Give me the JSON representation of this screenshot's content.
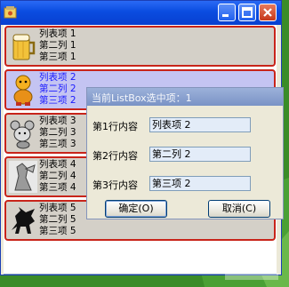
{
  "window": {
    "title": "",
    "buttons": [
      "minimize-button",
      "maximize-button",
      "close-button"
    ]
  },
  "list": {
    "items": [
      {
        "icon": "beer-mug-icon",
        "lines": [
          "列表项 1",
          "第二列 1",
          "第三项 1"
        ],
        "selected": false
      },
      {
        "icon": "cartoon-character-icon",
        "lines": [
          "列表项 2",
          "第二列 2",
          "第三项 2"
        ],
        "selected": true
      },
      {
        "icon": "mouse-character-icon",
        "lines": [
          "列表项 3",
          "第二列 3",
          "第三项 3"
        ],
        "selected": false
      },
      {
        "icon": "figure-icon",
        "lines": [
          "列表项 4",
          "第二列 4",
          "第三项 4"
        ],
        "selected": false
      },
      {
        "icon": "pegasus-icon",
        "lines": [
          "列表项 5",
          "第二列 5",
          "第三项 5"
        ],
        "selected": false
      }
    ]
  },
  "dialog": {
    "title": "当前ListBox选中项：1",
    "fields": [
      {
        "label": "第1行内容",
        "value": "列表项 2"
      },
      {
        "label": "第2行内容",
        "value": "第二列 2"
      },
      {
        "label": "第3行内容",
        "value": "第三项 2"
      }
    ],
    "ok_label": "确定(O)",
    "cancel_label": "取消(C)"
  },
  "colors": {
    "titlebar": "#0a4ce0",
    "row_border": "#c8241a",
    "row_bg": "#d4d0c8",
    "row_selected_bg": "#c4c4f2",
    "selected_text": "#1a1aff",
    "desktop": "#3a8c28"
  },
  "watermark": "好例子网"
}
